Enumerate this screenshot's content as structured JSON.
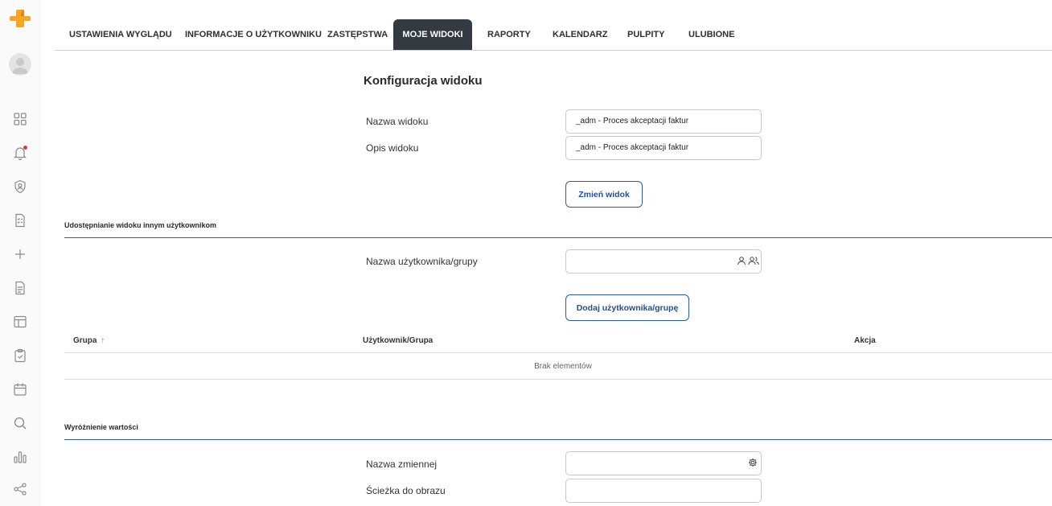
{
  "tabs": [
    {
      "label": "USTAWIENIA WYGLĄDU",
      "active": false
    },
    {
      "label": "INFORMACJE O UŻYTKOWNIKU",
      "active": false
    },
    {
      "label": "ZASTĘPSTWA",
      "active": false
    },
    {
      "label": "MOJE WIDOKI",
      "active": true
    },
    {
      "label": "RAPORTY",
      "active": false
    },
    {
      "label": "KALENDARZ",
      "active": false
    },
    {
      "label": "PULPITY",
      "active": false
    },
    {
      "label": "ULUBIONE",
      "active": false
    }
  ],
  "config": {
    "title": "Konfiguracja widoku",
    "name_label": "Nazwa widoku",
    "name_value": "_adm - Proces akceptacji faktur",
    "desc_label": "Opis widoku",
    "desc_value": "_adm - Proces akceptacji faktur",
    "change_button": "Zmień widok"
  },
  "sharing": {
    "section_title": "Udostępnianie widoku innym użytkownikom",
    "user_label": "Nazwa użytkownika/grupy",
    "user_value": "",
    "add_button": "Dodaj użytkownika/grupę",
    "columns": [
      "Grupa",
      "Użytkownik/Grupa",
      "Akcja"
    ],
    "sort_indicator": "↑",
    "empty_text": "Brak elementów"
  },
  "highlight": {
    "section_title": "Wyróżnienie wartości",
    "variable_label": "Nazwa zmiennej",
    "variable_value": "",
    "image_label": "Ścieżka do obrazu",
    "image_value": ""
  },
  "colors": {
    "accent": "#2a5ba8",
    "active_tab": "#333a42",
    "logo": "#f5a623",
    "notification": "#e23b2e"
  }
}
